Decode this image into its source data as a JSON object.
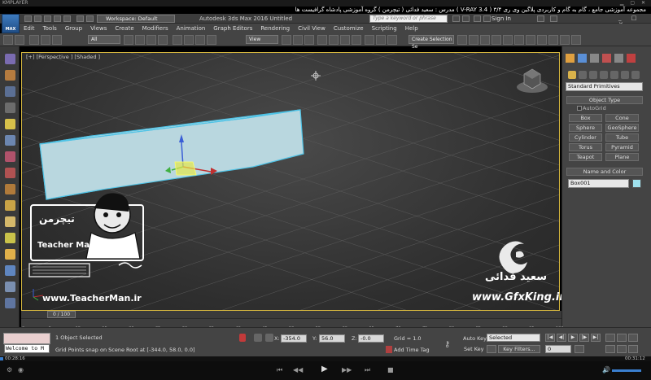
{
  "player": {
    "name": "KMPLAYER",
    "course_title": "مجموعه آموزشی جامع ، گام به گام و کاربردی پلاگین وی ری ۳/۴ ( V-RAY 3.4 ) مدرس : سعید فدائی ( تیچرمن ) گروه آموزشی پادشاه گرافیست ها",
    "time_current": "00:28:16",
    "time_total": "00:31:12",
    "progress_fraction": 0.005
  },
  "max": {
    "logo_text": "MAX",
    "workspace": "Workspace: Default",
    "app_title": "Autodesk 3ds Max 2016     Untitled",
    "search_placeholder": "Type a keyword or phrase",
    "sign_in": "Sign In",
    "menus": [
      "Edit",
      "Tools",
      "Group",
      "Views",
      "Create",
      "Modifiers",
      "Animation",
      "Graph Editors",
      "Rendering",
      "Civil View",
      "Customize",
      "Scripting",
      "Help"
    ]
  },
  "toolbar": {
    "filter": "All",
    "ref_coord": "View",
    "selection_set": "Create Selection Se"
  },
  "viewport": {
    "label": "[+] [Perspective ] [Shaded ]"
  },
  "command_panel": {
    "category": "Standard Primitives",
    "object_type_title": "Object Type",
    "autogrid": "AutoGrid",
    "buttons": [
      "Box",
      "Cone",
      "Sphere",
      "GeoSphere",
      "Cylinder",
      "Tube",
      "Torus",
      "Pyramid",
      "Teapot",
      "Plane"
    ],
    "name_color_title": "Name and Color",
    "object_name": "Box001",
    "object_color": "#9fe0ec"
  },
  "watermarks": {
    "teacherman_url": "www.TeacherMan.ir",
    "teacherman_fa": "تیچرمن",
    "teacherman_en": "Teacher Man",
    "gfx_name": "سعید فدائی",
    "gfx_url": "www.GfxKing.ir"
  },
  "timeline": {
    "slider": "0 / 100",
    "ticks": [
      "0",
      "5",
      "10",
      "15",
      "20",
      "25",
      "30",
      "35",
      "40",
      "45",
      "50",
      "55",
      "60",
      "65",
      "70",
      "75",
      "80",
      "85",
      "90",
      "95",
      "100"
    ]
  },
  "status": {
    "listener": "Welcome to M",
    "selected_count": "1 Object Selected",
    "prompt": "Grid Points snap on Scene Root at [-344.0, 58.0, 0.0]",
    "x_label": "X:",
    "x": "-354.0",
    "y_label": "Y:",
    "y": "56.0",
    "z_label": "Z:",
    "z": "-0.0",
    "grid": "Grid = 1.0",
    "add_time_tag": "Add Time Tag",
    "auto_key": "Auto Key",
    "set_key": "Set Key",
    "key_mode": "Selected",
    "key_filters": "Key Filters...",
    "frame": "0"
  },
  "colors": {
    "viewport_border": "#d5b63e",
    "box_fill": "#b9d7df",
    "box_edge": "#4fc3e6"
  }
}
